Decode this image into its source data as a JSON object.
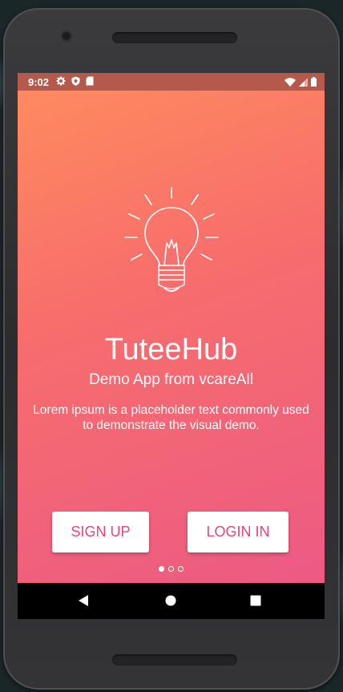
{
  "status_bar": {
    "time": "9:02",
    "left_icons": [
      "settings-icon",
      "shield-icon",
      "sd-card-icon"
    ],
    "right_icons": [
      "wifi-icon",
      "signal-icon",
      "battery-icon"
    ],
    "color": "#b55a4b"
  },
  "onboarding": {
    "icon": "lightbulb-icon",
    "title": "TuteeHub",
    "subtitle": "Demo App from vcareAll",
    "description": "Lorem ipsum is a placeholder text commonly used to demonstrate the visual demo.",
    "signup_label": "SIGN UP",
    "login_label": "LOGIN IN",
    "page_indicator": {
      "total": 3,
      "active": 1
    },
    "gradient": [
      "#ff8a5e",
      "#f76e6c",
      "#ec5a84"
    ],
    "button_text_color": "#e8457a"
  },
  "nav_bar": {
    "buttons": [
      "back-icon",
      "home-icon",
      "recents-icon"
    ]
  }
}
